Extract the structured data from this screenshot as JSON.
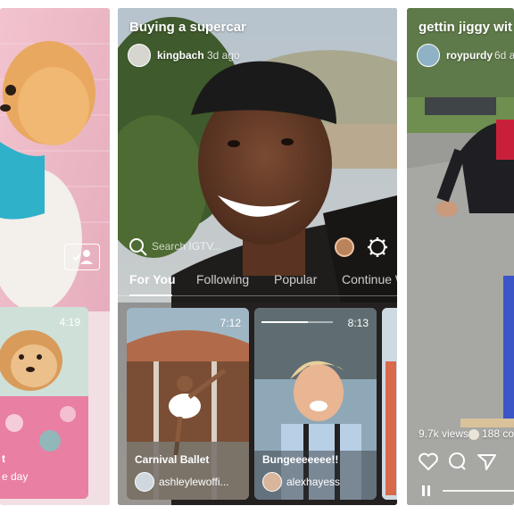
{
  "left_phone": {
    "thumb": {
      "duration": "4:19",
      "title_partial": "t",
      "subtitle_partial": "e day"
    }
  },
  "center_phone": {
    "video_title": "Buying a supercar",
    "author": "kingbach",
    "time_ago": "3d ago",
    "search": {
      "placeholder": "Search IGTV..."
    },
    "tabs": [
      {
        "label": "For You"
      },
      {
        "label": "Following"
      },
      {
        "label": "Popular"
      },
      {
        "label": "Continue W"
      }
    ],
    "thumbs": [
      {
        "duration": "7:12",
        "title": "Carnival Ballet",
        "author": "ashleylewoffi..."
      },
      {
        "duration": "8:13",
        "title": "Bungeeeeeee!!",
        "author": "alexhayess"
      }
    ]
  },
  "right_phone": {
    "video_title": "gettin jiggy wit",
    "author": "roypurdy",
    "time_ago": "6d a",
    "views": "9.7k views",
    "comments": "188 co"
  },
  "colors": {
    "accent_pink": "#e9b7c4",
    "white": "#ffffff"
  }
}
